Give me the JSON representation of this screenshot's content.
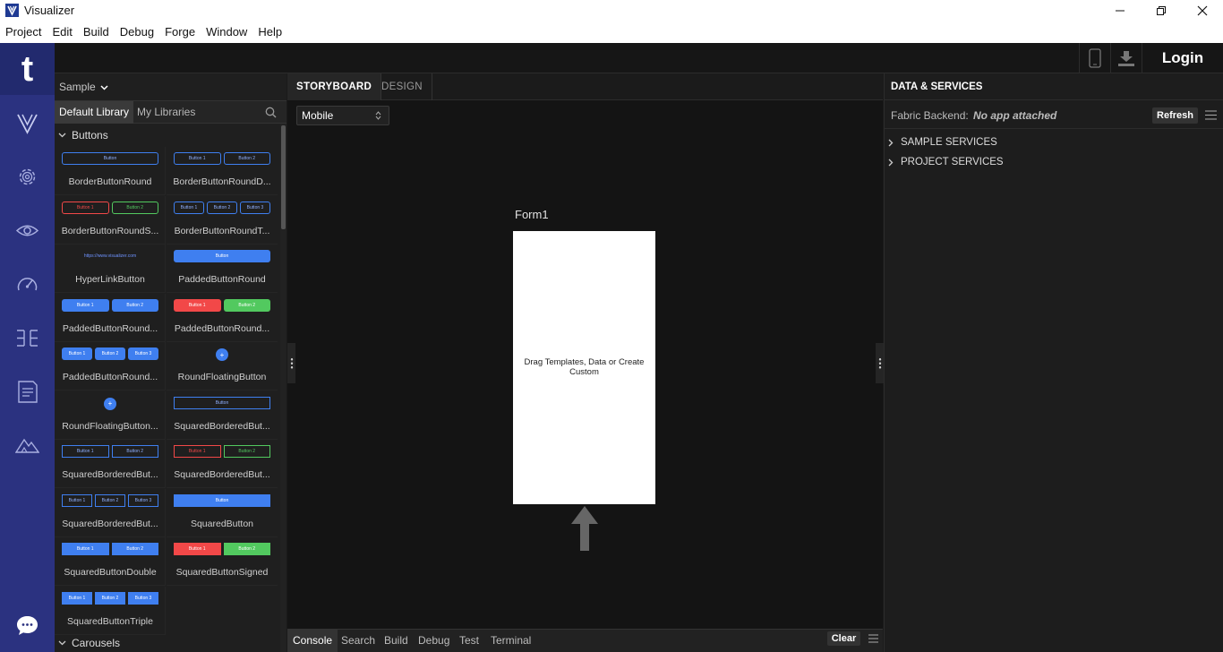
{
  "window": {
    "title": "Visualizer"
  },
  "menu": [
    "Project",
    "Edit",
    "Build",
    "Debug",
    "Forge",
    "Window",
    "Help"
  ],
  "header": {
    "login_label": "Login",
    "icons": [
      "device-icon",
      "download-icon"
    ]
  },
  "rail": {
    "brand_letter": "t",
    "icons": [
      "visualizer-logo-icon",
      "gear-icon",
      "eye-icon",
      "speedometer-icon",
      "frame-icon",
      "document-icon",
      "mountain-icon",
      "chat-icon"
    ]
  },
  "library": {
    "project_name": "Sample",
    "tabs": [
      "Default Library",
      "My Libraries"
    ],
    "section_buttons": "Buttons",
    "section_carousels": "Carousels",
    "items": [
      {
        "label": "BorderButtonRound",
        "thumb": [
          "Button"
        ],
        "style": "outline"
      },
      {
        "label": "BorderButtonRoundD...",
        "thumb": [
          "Button 1",
          "Button 2"
        ],
        "style": "outline"
      },
      {
        "label": "BorderButtonRoundS...",
        "thumb": [
          "Button 1",
          "Button 2"
        ],
        "style": "outline-signed"
      },
      {
        "label": "BorderButtonRoundT...",
        "thumb": [
          "Button 1",
          "Button 2",
          "Button 3"
        ],
        "style": "outline"
      },
      {
        "label": "HyperLinkButton",
        "thumb": [
          "https://www.visualizer.com"
        ],
        "style": "link"
      },
      {
        "label": "PaddedButtonRound",
        "thumb": [
          "Button"
        ],
        "style": "filled"
      },
      {
        "label": "PaddedButtonRound...",
        "thumb": [
          "Button 1",
          "Button 2"
        ],
        "style": "filled"
      },
      {
        "label": "PaddedButtonRound...",
        "thumb": [
          "Button 1",
          "Button 2"
        ],
        "style": "filled-signed"
      },
      {
        "label": "PaddedButtonRound...",
        "thumb": [
          "Button 1",
          "Button 2",
          "Button 3"
        ],
        "style": "filled"
      },
      {
        "label": "RoundFloatingButton",
        "thumb": [
          "+"
        ],
        "style": "fab"
      },
      {
        "label": "RoundFloatingButton...",
        "thumb": [
          "+"
        ],
        "style": "fab"
      },
      {
        "label": "SquaredBorderedBut...",
        "thumb": [
          "Button"
        ],
        "style": "outline-square"
      },
      {
        "label": "SquaredBorderedBut...",
        "thumb": [
          "Button 1",
          "Button 2"
        ],
        "style": "outline-square"
      },
      {
        "label": "SquaredBorderedBut...",
        "thumb": [
          "Button 1",
          "Button 2"
        ],
        "style": "outline-square-signed"
      },
      {
        "label": "SquaredBorderedBut...",
        "thumb": [
          "Button 1",
          "Button 2",
          "Button 3"
        ],
        "style": "outline-square"
      },
      {
        "label": "SquaredButton",
        "thumb": [
          "Button"
        ],
        "style": "filled-square"
      },
      {
        "label": "SquaredButtonDouble",
        "thumb": [
          "Button 1",
          "Button 2"
        ],
        "style": "filled-square"
      },
      {
        "label": "SquaredButtonSigned",
        "thumb": [
          "Button 1",
          "Button 2"
        ],
        "style": "filled-square-signed"
      },
      {
        "label": "SquaredButtonTriple",
        "thumb": [
          "Button 1",
          "Button 2",
          "Button 3"
        ],
        "style": "filled-square"
      }
    ]
  },
  "center": {
    "tabs": [
      "STORYBOARD",
      "DESIGN"
    ],
    "device_selected": "Mobile",
    "form_title": "Form1",
    "form_hint": "Drag Templates, Data or Create Custom",
    "bottom_tabs": [
      "Console",
      "Search",
      "Build",
      "Debug",
      "Test",
      "Terminal"
    ],
    "clear_label": "Clear"
  },
  "services": {
    "title": "DATA & SERVICES",
    "backend_label": "Fabric Backend:",
    "backend_value": "No app attached",
    "refresh_label": "Refresh",
    "rows": [
      "SAMPLE SERVICES",
      "PROJECT SERVICES"
    ]
  },
  "colors": {
    "rail": "#2b3280",
    "brand": "#222a6e",
    "accent_blue": "#3f7ff0",
    "accent_red": "#f24848",
    "accent_green": "#52c95f"
  }
}
